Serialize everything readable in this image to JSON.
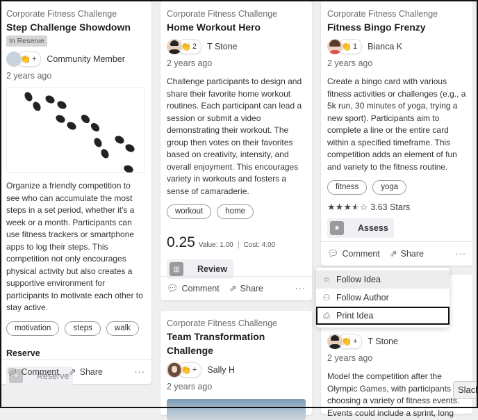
{
  "cards": [
    {
      "category": "Corporate Fitness Challenge",
      "title": "Step Challenge Showdown",
      "badge": "In Reserve",
      "clap": "+",
      "author": "Community Member",
      "ago": "2 years ago",
      "image": "footprints-image",
      "description": "Organize a friendly competition to see who can accumulate the most steps in a set period, whether it's a week or a month. Participants can use fitness trackers or smartphone apps to log their steps. This competition not only encourages physical activity but also creates a supportive environment for participants to motivate each other to stay active.",
      "tags": [
        "motivation",
        "steps",
        "walk"
      ],
      "section_label": "Reserve",
      "action_label": "Reserve",
      "footer": {
        "comment": "Comment",
        "share": "Share",
        "more": "···"
      }
    },
    {
      "category": "Corporate Fitness Challenge",
      "title": "Home Workout Hero",
      "clap": "2",
      "author": "T Stone",
      "ago": "2 years ago",
      "description": "Challenge participants to design and share their favorite home workout routines. Each participant can lead a session or submit a video demonstrating their workout. The group then votes on their favorites based on creativity, intensity, and overall enjoyment. This encourages variety in workouts and fosters a sense of camaraderie.",
      "tags": [
        "workout",
        "home"
      ],
      "score": {
        "value": "0.25",
        "value_label": "Value: 1.00",
        "cost_label": "Cost: 4.00"
      },
      "action_label": "Review",
      "footer": {
        "comment": "Comment",
        "share": "Share",
        "more": "···"
      }
    },
    {
      "category": "Corporate Fitness Challenge",
      "title": "Fitness Bingo Frenzy",
      "clap": "1",
      "author": "Bianca K",
      "ago": "2 years ago",
      "description": "Create a bingo card with various fitness activities or challenges (e.g., a 5k run, 30 minutes of yoga, trying a new sport). Participants aim to complete a line or the entire card within a specified timeframe. This competition adds an element of fun and variety to the fitness routine.",
      "tags": [
        "fitness",
        "yoga"
      ],
      "rating": {
        "value": 3.63,
        "max": 5,
        "label": "3.63 Stars"
      },
      "action_label": "Assess",
      "footer": {
        "comment": "Comment",
        "share": "Share",
        "more": "···"
      }
    },
    {
      "category": "Corporate Fitness Challenge",
      "title": "Team Transformation Challenge",
      "clap": "+",
      "author": "Sally H",
      "ago": "2 years ago"
    },
    {
      "clap": "+",
      "author": "T Stone",
      "ago": "2 years ago",
      "description": "Model the competition after the Olympic Games, with participants choosing a variety of fitness events. Events could include a sprint, long"
    }
  ],
  "menu": {
    "items": [
      {
        "label": "Follow Idea",
        "icon": "star-outline-icon"
      },
      {
        "label": "Follow Author",
        "icon": "user-follow-icon"
      },
      {
        "label": "Print Idea",
        "icon": "printer-icon"
      }
    ]
  },
  "tooltip": {
    "label": "Slack"
  }
}
